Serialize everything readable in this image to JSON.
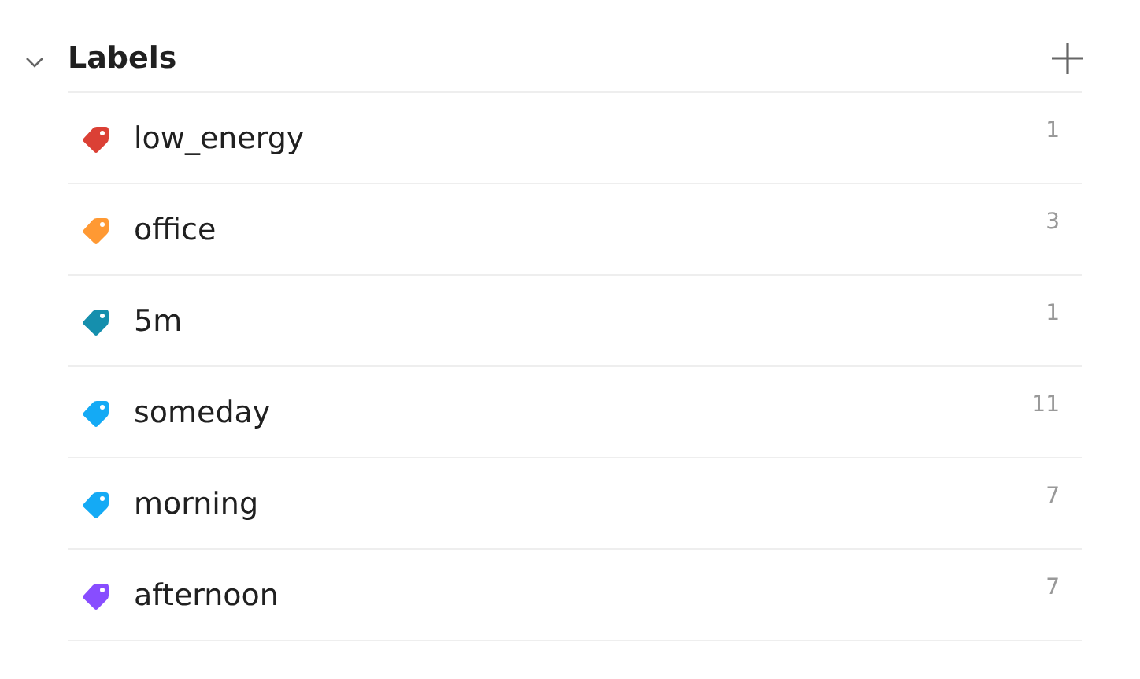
{
  "section": {
    "title": "Labels",
    "expanded": true
  },
  "labels": [
    {
      "name": "low_energy",
      "count": "1",
      "color": "#db4035"
    },
    {
      "name": "office",
      "count": "3",
      "color": "#ff9933"
    },
    {
      "name": "5m",
      "count": "1",
      "color": "#158fad"
    },
    {
      "name": "someday",
      "count": "11",
      "color": "#14aaf5"
    },
    {
      "name": "morning",
      "count": "7",
      "color": "#14aaf5"
    },
    {
      "name": "afternoon",
      "count": "7",
      "color": "#884dff"
    }
  ]
}
